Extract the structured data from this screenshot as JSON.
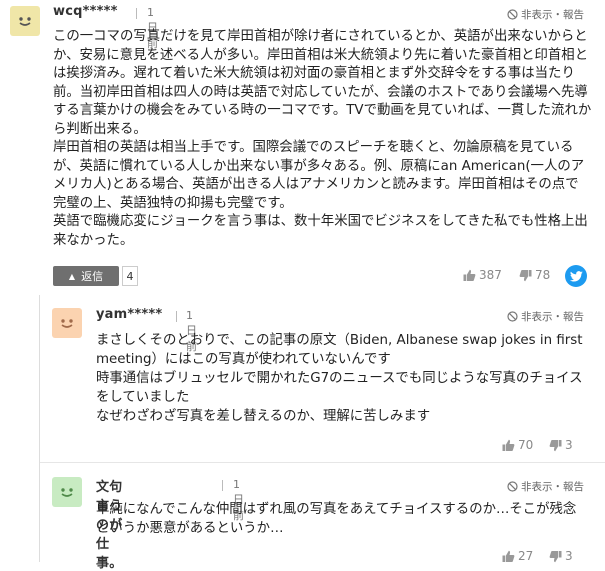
{
  "comment1": {
    "username": "wcq*****",
    "time": "1日前",
    "hide_report": "非表示・報告",
    "lines": [
      "この一コマの写真だけを見て岸田首相が除け者にされているとか、英語が出来ないからと",
      "か、安易に意見を述べる人が多い。岸田首相は米大統領より先に着いた豪首相と印首相と",
      "は挨拶済み。遅れて着いた米大統領は初対面の豪首相とまず外交辞令をする事は当たり",
      "前。当初岸田首相は四人の時は英語で対応していたが、会議のホストであり会議場へ先導",
      "する言葉かけの機会をみている時の一コマです。TVで動画を見ていれば、一貫した流れか",
      "ら判断出来る。",
      "岸田首相の英語は相当上手です。国際会議でのスピーチを聴くと、勿論原稿を見ている",
      "が、英語に慣れている人しか出来ない事が多々ある。例、原稿にan American(一人のア",
      "メリカ人)とある場合、英語が出きる人はアナメリカンと読みます。岸田首相はその点で",
      "完璧の上、英語独特の抑揚も完璧です。",
      "英語で臨機応変にジョークを言う事は、数十年米国でビジネスをしてきた私でも性格上出",
      "来なかった。"
    ],
    "reply_label": "返信",
    "reply_count": "4",
    "likes": "387",
    "dislikes": "78"
  },
  "reply1": {
    "username": "yam*****",
    "time": "1日前",
    "hide_report": "非表示・報告",
    "lines": [
      "まさしくそのとおりで、この記事の原文（Biden, Albanese swap jokes in first",
      "meeting）にはこの写真が使われていないんです",
      "時事通信はブリュッセルで開かれたG7のニュースでも同じような写真のチョイス",
      "をしていました",
      "なぜわざわざ写真を差し替えるのか、理解に苦しみます"
    ],
    "likes": "70",
    "dislikes": "3"
  },
  "reply2": {
    "username": "文句言うのが仕事。",
    "time": "1日前",
    "hide_report": "非表示・報告",
    "lines": [
      "単純になんでこんな仲間はずれ風の写真をあえてチョイスするのか…そこが残念",
      "というか悪意があるというか…"
    ],
    "likes": "27",
    "dislikes": "3"
  },
  "colors": {
    "avatar_yellow": "#f0e6a8",
    "avatar_orange": "#fbd3b0",
    "avatar_green": "#c8ebc2",
    "reply_button": "#6f6f6f",
    "twitter": "#1d9bf0"
  }
}
